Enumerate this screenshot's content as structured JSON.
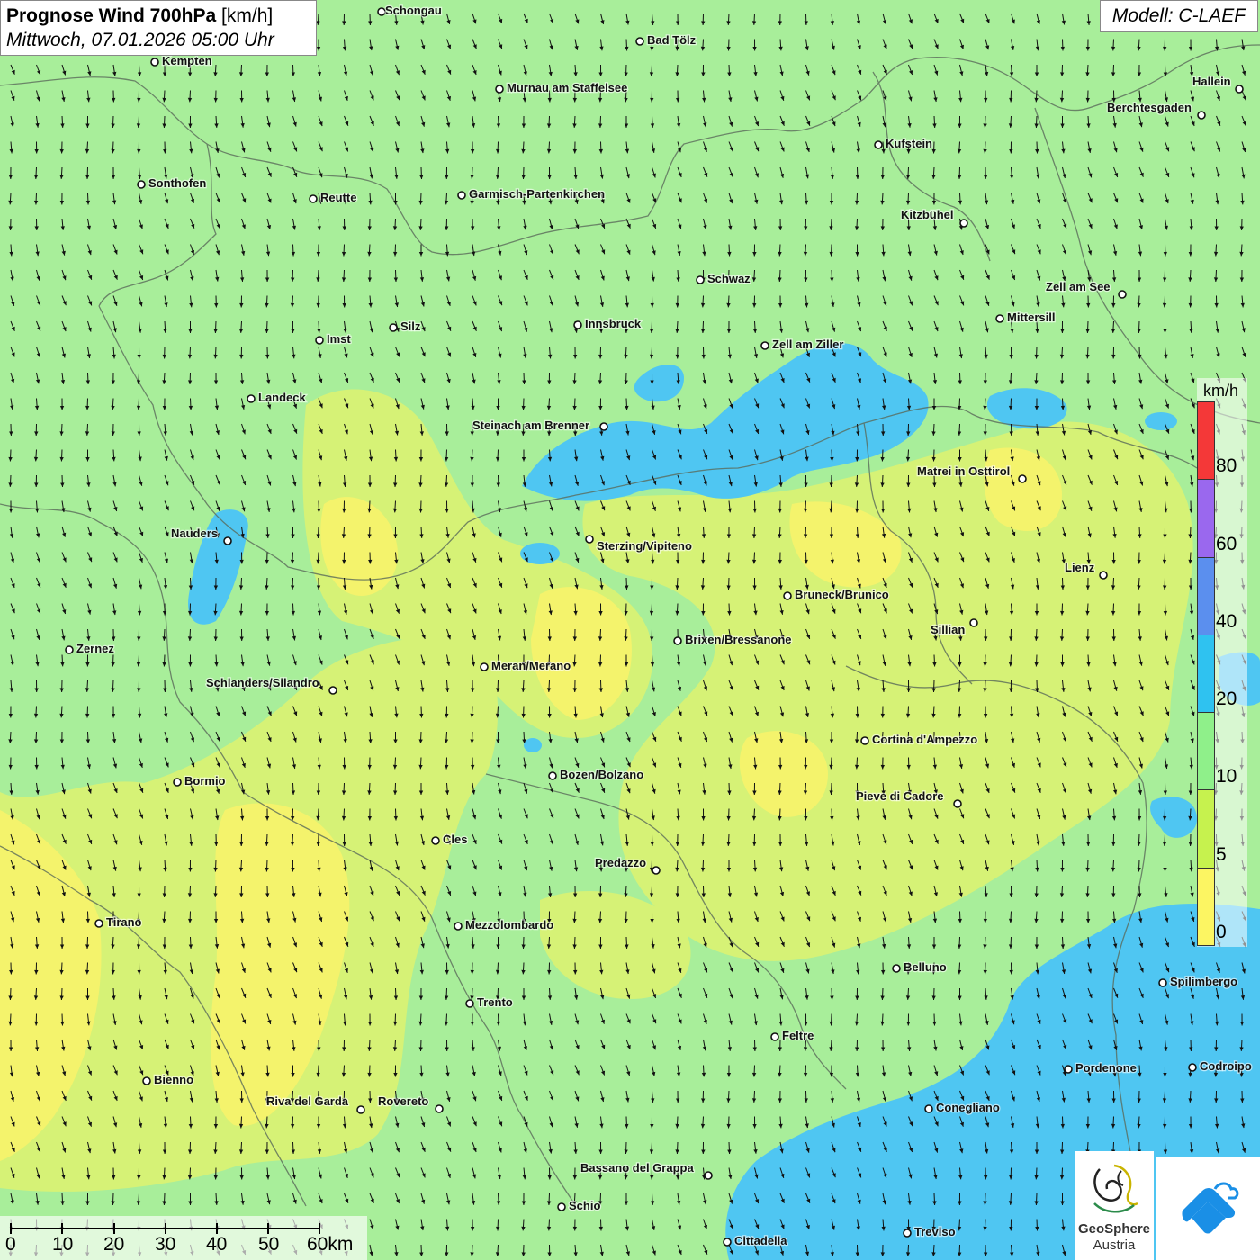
{
  "header": {
    "title_bold": "Prognose Wind 700hPa",
    "title_unit": "[km/h]",
    "subtitle": "Mittwoch, 07.01.2026 05:00 Uhr",
    "model": "Modell: C-LAEF"
  },
  "legend": {
    "unit": "km/h",
    "bands": [
      {
        "label": "0",
        "color": "#fcf562"
      },
      {
        "label": "5",
        "color": "#c6f24e"
      },
      {
        "label": "10",
        "color": "#8ff08a"
      },
      {
        "label": "20",
        "color": "#2fc2f0"
      },
      {
        "label": "40",
        "color": "#5b8fee"
      },
      {
        "label": "60",
        "color": "#9a68ee"
      },
      {
        "label": "80",
        "color": "#f43838"
      }
    ]
  },
  "scale_bar": {
    "labels": [
      "0",
      "10",
      "20",
      "30",
      "40",
      "50",
      "60km"
    ]
  },
  "cities": [
    "Schongau",
    "Bad Tölz",
    "Kempten",
    "Murnau am Staffelsee",
    "Hallein",
    "Berchtesgaden",
    "Kufstein",
    "Sonthofen",
    "Reutte",
    "Garmisch-Partenkirchen",
    "Kitzbühel",
    "Schwaz",
    "Zell am See",
    "Mittersill",
    "Silz",
    "Innsbruck",
    "Imst",
    "Zell am Ziller",
    "Landeck",
    "Steinach am Brenner",
    "Matrei in Osttirol",
    "Nauders",
    "Sterzing/Vipiteno",
    "Lienz",
    "Bruneck/Brunico",
    "Sillian",
    "Brixen/Bressanone",
    "Zernez",
    "Meran/Merano",
    "Schlanders/Silandro",
    "Cortina d'Ampezzo",
    "Bozen/Bolzano",
    "Bormio",
    "Pieve di Cadore",
    "Cles",
    "Predazzo",
    "Tirano",
    "Mezzolombardo",
    "Belluno",
    "Spilimbergo",
    "Trento",
    "Feltre",
    "Pordenone",
    "Codroipo",
    "Bienno",
    "Riva del Garda",
    "Rovereto",
    "Conegliano",
    "Bassano del Grappa",
    "Schio",
    "Treviso",
    "Cittadella"
  ],
  "logos": {
    "geosphere_line1": "GeoSphere",
    "geosphere_line2": "Austria"
  },
  "colors": {
    "background": "#a8ee9a",
    "calm": "#fcf562",
    "light": "#d2f27a",
    "strong": "#4fc6f2",
    "border": "#555555"
  }
}
